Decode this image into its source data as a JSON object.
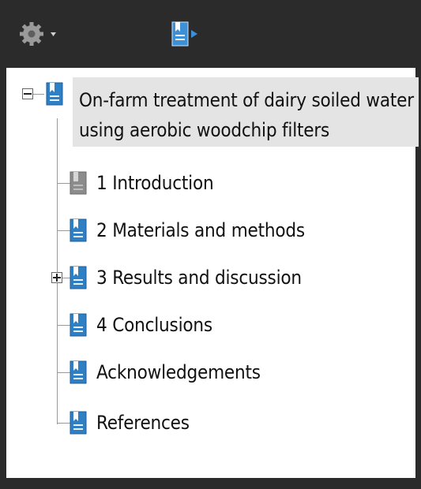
{
  "toolbar": {
    "options_icon": "gear-icon",
    "expand_bookmark_icon": "bookmark-expand-icon"
  },
  "bookmarks": {
    "root": {
      "label": "On-farm treatment of dairy soiled water using aerobic woodchip filters",
      "expanded": true
    },
    "items": [
      {
        "label": "1 Introduction",
        "selected": true,
        "expandable": false
      },
      {
        "label": "2 Materials and methods",
        "selected": false,
        "expandable": false
      },
      {
        "label": "3 Results and discussion",
        "selected": false,
        "expandable": true
      },
      {
        "label": "4 Conclusions",
        "selected": false,
        "expandable": false
      },
      {
        "label": "Acknowledgements",
        "selected": false,
        "expandable": false
      },
      {
        "label": "References",
        "selected": false,
        "expandable": false
      }
    ]
  },
  "colors": {
    "background": "#2b2b2b",
    "panel": "#ffffff",
    "root_highlight": "#e4e4e4",
    "bookmark_blue": "#2f7fc4",
    "bookmark_gray": "#8c8c8c"
  }
}
